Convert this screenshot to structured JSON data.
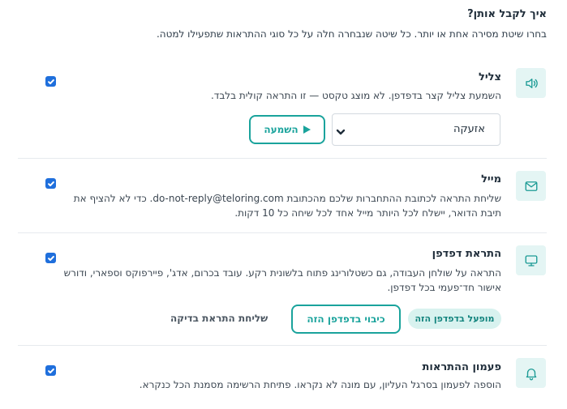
{
  "header": {
    "title": "איך לקבל אותן?",
    "subtitle": "בחרו שיטת מסירה אחת או יותר. כל שיטה שנבחרה חלה על כל סוגי ההתראות שתפעילו למטה."
  },
  "methods": [
    {
      "icon": "speaker-icon",
      "title": "צליל",
      "description_lines": [
        "השמעת צליל קצר בדפדפן. לא מוצג טקסט — זו התראה קולית בלבד."
      ],
      "enabled": true,
      "sound_select": {
        "value": "אזעקה"
      },
      "play_label": "השמעה"
    },
    {
      "icon": "mail-icon",
      "title": "מייל",
      "description_lines": [
        "שליחת התראה לכתובת ההתחברות שלכם מהכתובת do-not-reply@teloring.com. כדי לא להציף את",
        "תיבת הדואר, יישלח לכל היותר מייל אחד לכל שיחה כל 10 דקות."
      ],
      "enabled": true
    },
    {
      "icon": "monitor-icon",
      "title": "התראת דפדפן",
      "description_lines": [
        "התראה על שולחן העבודה, גם כשטלורינג פתוח בלשונית רקע. עובד בכרום, אדג', פיירפוקס וספארי, ודורש",
        "אישור חד־פעמי בכל דפדפן."
      ],
      "enabled": true,
      "status_badge": "מופעל בדפדפן הזה",
      "disable_label": "כיבוי בדפדפן הזה",
      "test_label": "שליחת התראת בדיקה"
    },
    {
      "icon": "bell-icon",
      "title": "פעמון ההתראות",
      "description_lines": [
        "הוספה לפעמון בסרגל העליון, עם מונה לא נקראו. פתיחת הרשימה מסמנת הכל כנקרא."
      ],
      "enabled": true
    }
  ],
  "colors": {
    "accent": "#1aa39c",
    "checkbox": "#1f6fdc",
    "icon_bg": "#e4f5f4"
  }
}
